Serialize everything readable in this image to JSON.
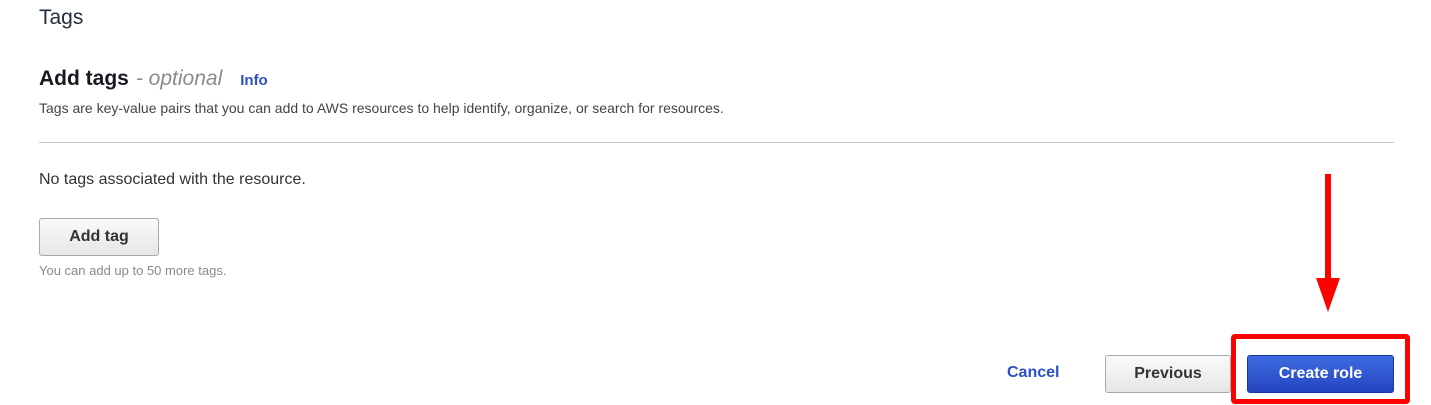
{
  "section": {
    "title": "Tags"
  },
  "add_tags": {
    "title": "Add tags",
    "optional": "- optional",
    "info_link": "Info",
    "description": "Tags are key-value pairs that you can add to AWS resources to help identify, organize, or search for resources."
  },
  "tags_list": {
    "empty_message": "No tags associated with the resource.",
    "add_button_label": "Add tag",
    "limit_text": "You can add up to 50 more tags."
  },
  "footer": {
    "cancel_label": "Cancel",
    "previous_label": "Previous",
    "create_label": "Create role"
  },
  "annotation": {
    "color": "#ff0000",
    "arrow_icon": "arrow-down-icon",
    "highlight_target": "create-role-button"
  },
  "colors": {
    "link": "#2b4fc4",
    "primary_button": "#2b4fc4",
    "annotation": "#ff0000"
  }
}
